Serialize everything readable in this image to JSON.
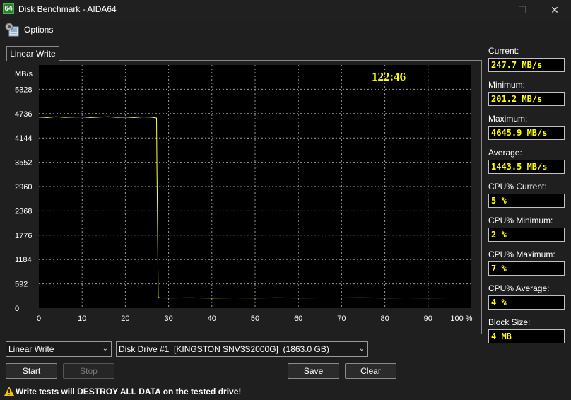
{
  "window": {
    "title": "Disk Benchmark - AIDA64",
    "app_icon_text": "64",
    "minimize_glyph": "—",
    "maximize_glyph": "☐",
    "close_glyph": "✕"
  },
  "menu": {
    "options_label": "Options",
    "icon": "options-gear-icon"
  },
  "tab": {
    "label": "Linear Write"
  },
  "graph": {
    "timer": "122:46",
    "unit_label": "MB/s",
    "percent_suffix": "%",
    "colors": {
      "background": "#000000",
      "grid": "#9a9a9a",
      "line": "#ffff40",
      "timer": "#ffff00"
    }
  },
  "chart_data": {
    "type": "line",
    "xlabel": "",
    "ylabel": "MB/s",
    "x_ticks": [
      "0",
      "10",
      "20",
      "30",
      "40",
      "50",
      "60",
      "70",
      "80",
      "90",
      "100 %"
    ],
    "y_ticks": [
      "5328",
      "4736",
      "4144",
      "3552",
      "2960",
      "2368",
      "1776",
      "1184",
      "592",
      "0"
    ],
    "xlim": [
      0,
      100
    ],
    "ylim": [
      0,
      5920
    ],
    "grid": true,
    "series": [
      {
        "x": [
          0,
          2,
          4,
          6,
          8,
          10,
          12,
          14,
          16,
          18,
          20,
          22,
          24,
          26,
          27.2,
          27.3,
          27.5,
          27.6,
          28,
          30,
          35,
          40,
          45,
          50,
          55,
          60,
          65,
          70,
          75,
          80,
          85,
          90,
          95,
          100
        ],
        "values": [
          4650,
          4640,
          4660,
          4645,
          4650,
          4655,
          4640,
          4650,
          4660,
          4645,
          4650,
          4640,
          4655,
          4648,
          4630,
          3400,
          1400,
          260,
          250,
          248,
          252,
          246,
          250,
          248,
          252,
          247,
          250,
          249,
          251,
          248,
          250,
          247,
          249,
          250
        ]
      }
    ]
  },
  "stats": [
    {
      "label": "Current:",
      "value": "247.7 MB/s"
    },
    {
      "label": "Minimum:",
      "value": "201.2 MB/s"
    },
    {
      "label": "Maximum:",
      "value": "4645.9 MB/s"
    },
    {
      "label": "Average:",
      "value": "1443.5 MB/s"
    },
    {
      "label": "CPU% Current:",
      "value": "5 %"
    },
    {
      "label": "CPU% Minimum:",
      "value": "2 %"
    },
    {
      "label": "CPU% Maximum:",
      "value": "7 %"
    },
    {
      "label": "CPU% Average:",
      "value": "4 %"
    },
    {
      "label": "Block Size:",
      "value": "4 MB"
    }
  ],
  "controls": {
    "test_select": "Linear Write",
    "drive_select": "Disk Drive #1  [KINGSTON SNV3S2000G]  (1863.0 GB)",
    "start_label": "Start",
    "stop_label": "Stop",
    "save_label": "Save",
    "clear_label": "Clear"
  },
  "warning": {
    "text": "Write tests will DESTROY ALL DATA on the tested drive!",
    "icon": "warning-triangle-icon"
  }
}
